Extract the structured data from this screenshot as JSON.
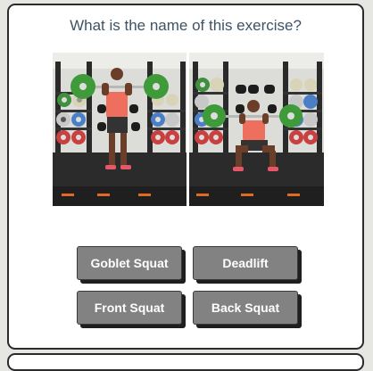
{
  "quiz": {
    "question": "What is the name of this exercise?",
    "answers": [
      "Goblet Squat",
      "Deadlift",
      "Front Squat",
      "Back Squat"
    ]
  },
  "colors": {
    "question_text": "#3d5366",
    "button_bg": "#828282",
    "button_shadow": "#1f1f1f",
    "card_border": "#2b2b2b"
  }
}
